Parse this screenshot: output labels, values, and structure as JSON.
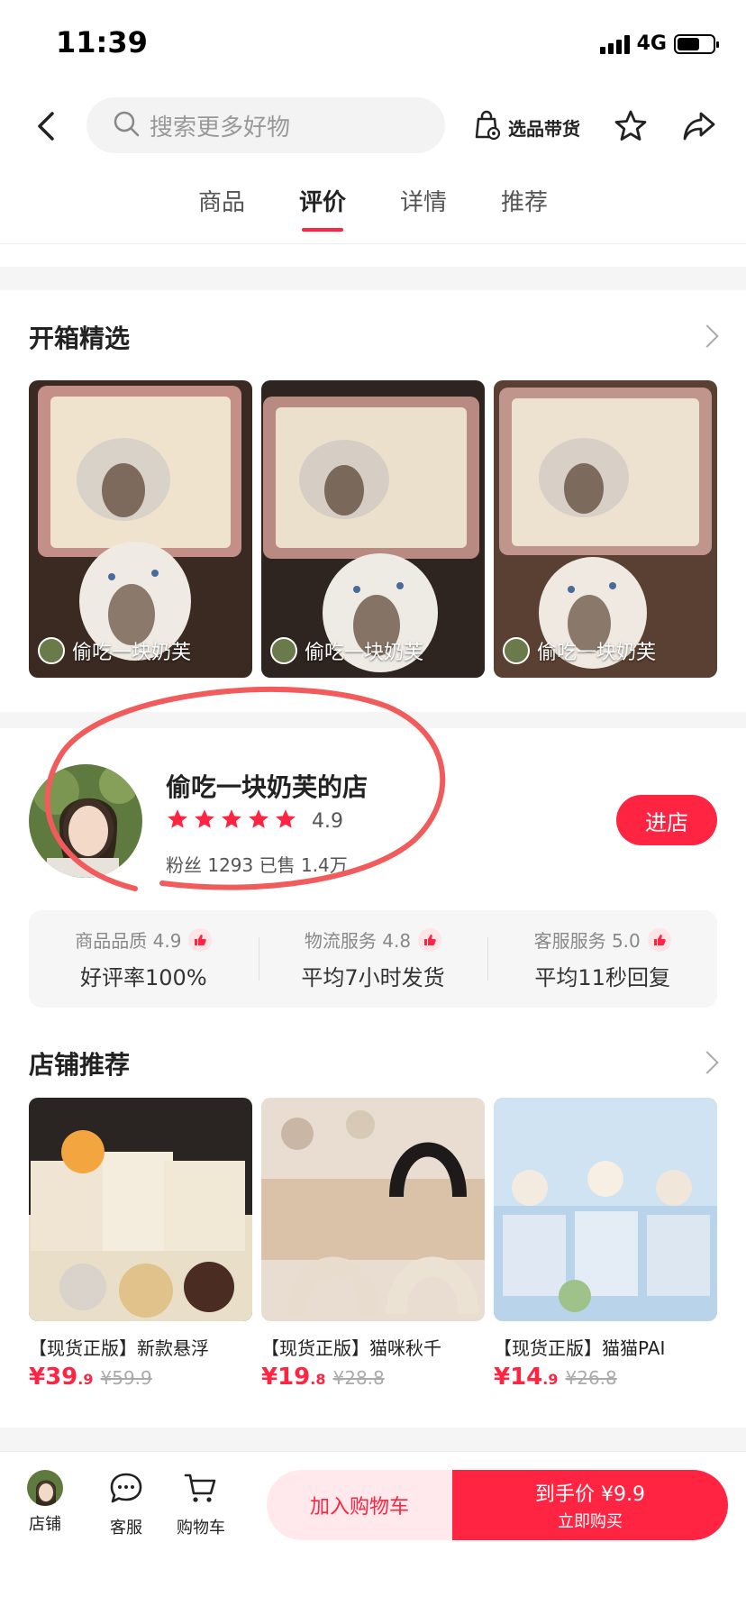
{
  "status_bar": {
    "time": "11:39",
    "network": "4G"
  },
  "header": {
    "search_placeholder": "搜索更多好物",
    "select_goods_label": "选品带货",
    "icons": [
      "back-icon",
      "search-icon",
      "bag-icon",
      "star-icon",
      "share-icon"
    ]
  },
  "tabs": [
    {
      "label": "商品",
      "active": false
    },
    {
      "label": "评价",
      "active": true
    },
    {
      "label": "详情",
      "active": false
    },
    {
      "label": "推荐",
      "active": false
    }
  ],
  "unboxing": {
    "title": "开箱精选",
    "items": [
      {
        "user": "偷吃一块奶芙"
      },
      {
        "user": "偷吃一块奶芙"
      },
      {
        "user": "偷吃一块奶芙"
      }
    ]
  },
  "shop": {
    "name": "偷吃一块奶芙的店",
    "rating": "4.9",
    "stars": 5,
    "stats": "粉丝 1293  已售 1.4万",
    "enter_label": "进店",
    "services": [
      {
        "top": "商品品质 4.9",
        "bottom": "好评率100%"
      },
      {
        "top": "物流服务 4.8",
        "bottom": "平均7小时发货"
      },
      {
        "top": "客服服务 5.0",
        "bottom": "平均11秒回复"
      }
    ]
  },
  "recommend": {
    "title": "店铺推荐",
    "products": [
      {
        "title": "【现货正版】新款悬浮",
        "price_int": "¥39",
        "price_dec": ".9",
        "orig": "¥59.9"
      },
      {
        "title": "【现货正版】猫咪秋千",
        "price_int": "¥19",
        "price_dec": ".8",
        "orig": "¥28.8"
      },
      {
        "title": "【现货正版】猫猫PAI",
        "price_int": "¥14",
        "price_dec": ".9",
        "orig": "¥26.8"
      }
    ]
  },
  "bottom_bar": {
    "shop_label": "店铺",
    "service_label": "客服",
    "cart_label": "购物车",
    "add_cart": "加入购物车",
    "buy_main": "到手价 ¥9.9",
    "buy_sub": "立即购买"
  },
  "colors": {
    "accent": "#ff2442",
    "annotation": "#f25b5b"
  }
}
